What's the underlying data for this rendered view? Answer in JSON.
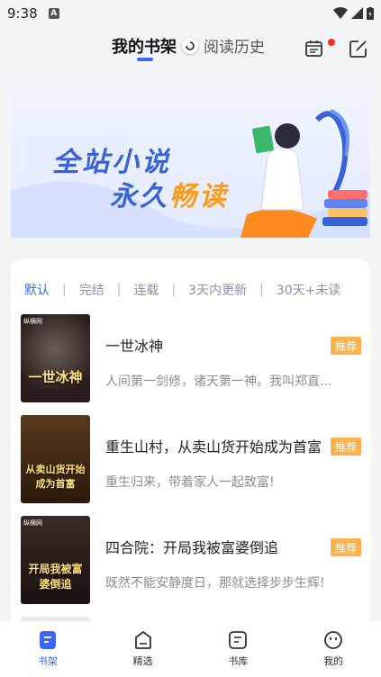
{
  "status_bar": {
    "time": "9:38",
    "notif_letter": "A"
  },
  "header": {
    "tab_shelf": "我的书架",
    "tab_history": "阅读历史"
  },
  "banner": {
    "line1": "全站小说",
    "line2_a": "永久",
    "line2_b": "畅读"
  },
  "filters": {
    "items": [
      "默认",
      "完结",
      "连载",
      "3天内更新",
      "30天+未读"
    ],
    "active_index": 0,
    "separator": "|"
  },
  "books": [
    {
      "title": "一世冰神",
      "desc": "人间第一剑修，诸天第一神。我叫郑直...",
      "badge": "推荐",
      "cover_text": "一世冰神",
      "cover_tag": "纵横网"
    },
    {
      "title": "重生山村，从卖山货开始成为首富",
      "desc": "重生归来，带着家人一起致富!",
      "badge": "推荐",
      "cover_text": "从卖山货开始成为首富",
      "cover_tag": ""
    },
    {
      "title": "四合院：开局我被富婆倒追",
      "desc": "既然不能安静度日，那就选择步步生辉!",
      "badge": "推荐",
      "cover_text": "开局我被富婆倒追",
      "cover_tag": "纵横网"
    }
  ],
  "bottom_nav": [
    {
      "label": "书架",
      "icon": "bookshelf-icon",
      "active": true
    },
    {
      "label": "精选",
      "icon": "featured-icon",
      "active": false
    },
    {
      "label": "书库",
      "icon": "library-icon",
      "active": false
    },
    {
      "label": "我的",
      "icon": "profile-icon",
      "active": false
    }
  ],
  "colors": {
    "accent": "#3a66ff",
    "badge": "#ffb24b",
    "dot": "#ff2b2b"
  }
}
